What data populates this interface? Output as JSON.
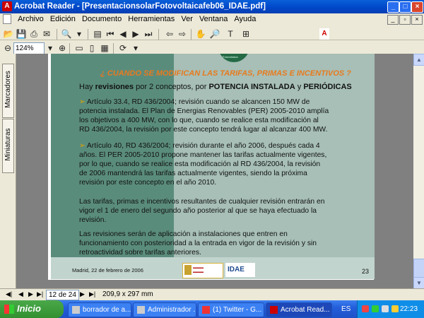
{
  "window": {
    "title": "Acrobat Reader - [PresentacionsolarFotovoltaicafeb06_IDAE.pdf]"
  },
  "menu": {
    "items": [
      "Archivo",
      "Edición",
      "Documento",
      "Herramientas",
      "Ver",
      "Ventana",
      "Ayuda"
    ]
  },
  "toolbar": {
    "zoom": "124%"
  },
  "left_panel": {
    "tabs": [
      "Marcadores",
      "Miniaturas"
    ]
  },
  "slide": {
    "heading": "¿ CUANDO SE MODIFICAN LAS TARIFAS, PRIMAS E INCENTIVOS ?",
    "intro_pre": "Hay ",
    "intro_b1": "revisiones",
    "intro_mid": " por 2 conceptos, por ",
    "intro_b2": "POTENCIA INSTALADA",
    "intro_and": " y ",
    "intro_b3": "PERIÓDICAS",
    "p1_lines": [
      "Artículo 33.4, RD 436/2004; revisión cuando se alcancen 150 MW de",
      "potencia instalada. El Plan de Energias Renovables (PER) 2005-2010 amplía",
      "los objetivos a 400 MW, con lo que, cuando se realice esta modificación al",
      "RD 436/2004, la revisión por este concepto tendrá lugar al alcanzar 400 MW."
    ],
    "p2_lines": [
      "Artículo 40, RD 436/2004; revisión durante el año 2006, después cada 4",
      "años. El PER 2005-2010 propone mantener las tarifas actualmente vigentes,",
      "por lo que, cuando se realice esta modificación al RD 436/2004, la revisión",
      "de 2006 mantendrá las tarifas actualmente vigentes, siendo la próxima",
      "revisión por este concepto en el año 2010."
    ],
    "p3_lines": [
      "Las tarifas, primas e incentivos resultantes de cualquier revisión entrarán en",
      "vigor el 1 de enero del segundo año posterior al que se haya efectuado la",
      "revisión."
    ],
    "p4_lines": [
      "Las revisiones serán de aplicación a instalaciones que entren en",
      "funcionamiento con posterioridad a la entrada en vigor de la revisión y sin",
      "retroactividad sobre tarifas anteriores."
    ],
    "footer_date": "Madrid, 22 de febrero de 2006",
    "page_number": "23",
    "logo_idae": "IDAE",
    "logo_caption": "Fotovoltaica"
  },
  "status": {
    "page": "12 de 24",
    "page_size": "209,9 x 297 mm"
  },
  "taskbar": {
    "start": "Inicio",
    "tasks": [
      "borrador de a...",
      "Administrador ...",
      "(1) Twitter - G...",
      "Acrobat Read..."
    ],
    "lang": "ES",
    "clock": "22:23"
  },
  "colors": {
    "heading": "#e87a1e",
    "slide_dark": "#5a8c7c",
    "slide_light": "#a7bfb6",
    "titlebar": "#0046c8",
    "taskbar": "#245edb"
  }
}
